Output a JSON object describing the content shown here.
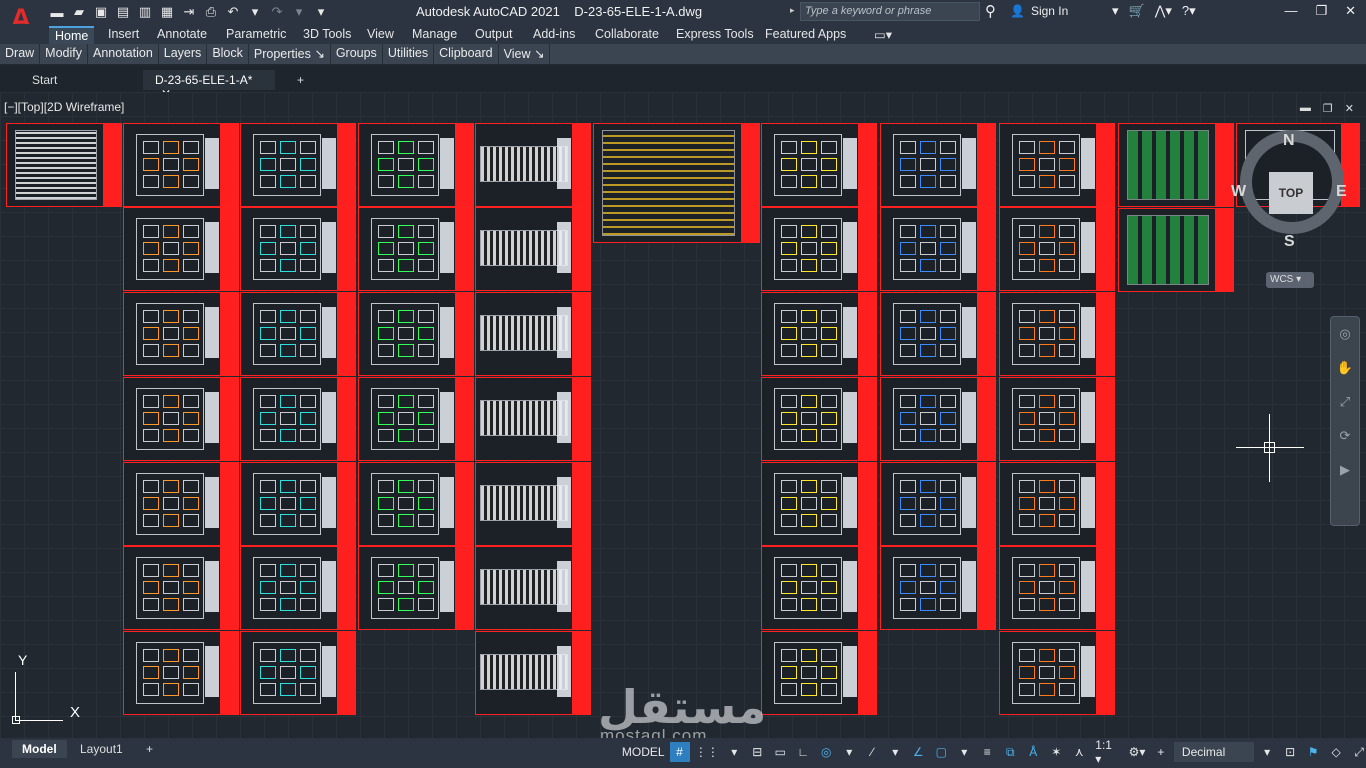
{
  "app": {
    "logo_letter": "A",
    "title": "Autodesk AutoCAD 2021    D-23-65-ELE-1-A.dwg",
    "search_placeholder": "Type a keyword or phrase",
    "sign_in": "Sign In"
  },
  "ribbon_tabs": [
    "Home",
    "Insert",
    "Annotate",
    "Parametric",
    "3D Tools",
    "View",
    "Manage",
    "Output",
    "Add-ins",
    "Collaborate",
    "Express Tools",
    "Featured Apps"
  ],
  "ribbon_panels": [
    "Draw",
    "Modify",
    "Annotation",
    "Layers",
    "Block",
    "Properties ↘",
    "Groups",
    "Utilities",
    "Clipboard",
    "View ↘"
  ],
  "doc_tabs": [
    {
      "label": "Start"
    },
    {
      "label": "D-23-65-ELE-1-A*"
    }
  ],
  "viewport": {
    "label": "[−][Top][2D Wireframe]"
  },
  "viewcube": {
    "n": "N",
    "s": "S",
    "w": "W",
    "e": "E",
    "top": "TOP",
    "wcs": "WCS ▾"
  },
  "ucs": {
    "x": "X",
    "y": "Y"
  },
  "layout_tabs": [
    "Model",
    "Layout1",
    "+"
  ],
  "status": {
    "model": "MODEL",
    "scale": "1:1 ▾",
    "units": "Decimal"
  },
  "watermark": {
    "line1": "مستقل",
    "line2": "mostaql.com"
  },
  "colors": {
    "accent_red": "#ff1f1f",
    "accent_blue": "#4aa3df"
  }
}
